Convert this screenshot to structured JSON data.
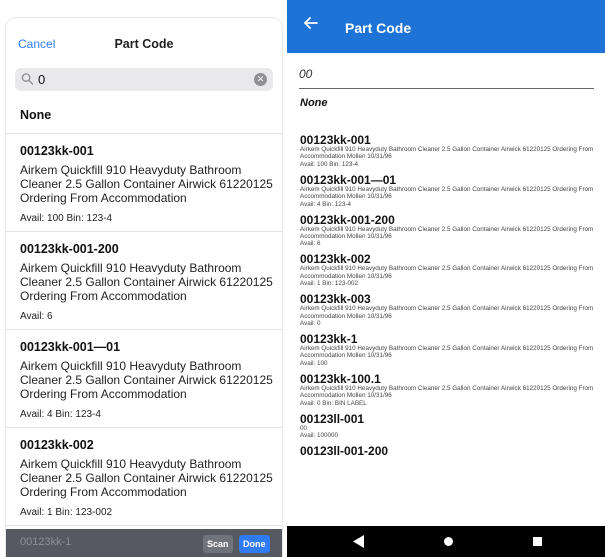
{
  "ios": {
    "nav": {
      "cancel_label": "Cancel",
      "title": "Part Code"
    },
    "search": {
      "query": "0"
    },
    "none_label": "None",
    "items": [
      {
        "code": "00123kk-001",
        "description": "Airkem Quickfill 910 Heavyduty Bathroom Cleaner 2.5 Gallon Container Airwick 61220125 Ordering From Accommodation",
        "avail": "Avail: 100  Bin: 123-4"
      },
      {
        "code": "00123kk-001-200",
        "description": "Airkem Quickfill 910 Heavyduty Bathroom Cleaner 2.5 Gallon Container Airwick 61220125 Ordering From Accommodation",
        "avail": "Avail: 6"
      },
      {
        "code": "00123kk-001—01",
        "description": "Airkem Quickfill 910 Heavyduty Bathroom Cleaner 2.5 Gallon Container Airwick 61220125 Ordering From Accommodation",
        "avail": "Avail: 4   Bin: 123-4"
      },
      {
        "code": "00123kk-002",
        "description": "Airkem Quickfill 910 Heavyduty Bathroom Cleaner 2.5 Gallon Container Airwick 61220125 Ordering From Accommodation",
        "avail": "Avail: 1   Bin: 123-002"
      }
    ],
    "keyboard": {
      "ghost_text": "00123kk-1",
      "scan_label": "Scan",
      "done_label": "Done"
    }
  },
  "android": {
    "appbar": {
      "title": "Part Code"
    },
    "field_value": "00",
    "none_label": "None",
    "items": [
      {
        "code": "00123kk-001",
        "description": "Airkem Quickfill 910 Heavyduty Bathroom Cleaner 2.5 Gallon Container Airwick 61220125 Ordering From Accommodation Mollen 10/31/96",
        "avail": "Avail: 100  Bin: 123-4"
      },
      {
        "code": "00123kk-001—01",
        "description": "Airkem Quickfill 910 Heavyduty Bathroom Cleaner 2.5 Gallon Container Airwick 61220125 Ordering From Accommodation Mollen 10/31/96",
        "avail": "Avail: 4  Bin: 123-4"
      },
      {
        "code": "00123kk-001-200",
        "description": "Airkem Quickfill 910 Heavyduty Bathroom Cleaner 2.5 Gallon Container Airwick 61220125 Ordering From Accommodation Mollen 10/31/96",
        "avail": "Avail: 6"
      },
      {
        "code": "00123kk-002",
        "description": "Airkem Quickfill 910 Heavyduty Bathroom Cleaner 2.5 Gallon Container Airwick 61220125 Ordering From Accommodation Mollen 10/31/96",
        "avail": "Avail: 1  Bin: 123-002"
      },
      {
        "code": "00123kk-003",
        "description": "Airkem Quickfill 910 Heavyduty Bathroom Cleaner 2.5 Gallon Container Airwick 61220125 Ordering From Accommodation Mollen 10/31/96",
        "avail": "Avail: 0"
      },
      {
        "code": "00123kk-1",
        "description": "Airkem Quickfill 910 Heavyduty Bathroom Cleaner 2.5 Gallon Container Airwick 61220125 Ordering From Accommodation Mollen 10/31/96",
        "avail": "Avail: 100"
      },
      {
        "code": "00123kk-100.1",
        "description": "Airkem Quickfill 910 Heavyduty Bathroom Cleaner 2.5 Gallon Container Airwick 61220125 Ordering From Accommodation Mollen 10/31/96",
        "avail": "Avail: 0  Bin: BIN LABEL"
      },
      {
        "code": "00123ll-001",
        "description": "00",
        "avail": "Avail: 100000"
      },
      {
        "code": "00123ll-001-200",
        "description": "",
        "avail": ""
      }
    ]
  },
  "colors": {
    "ios_accent": "#2f7cf6",
    "android_appbar": "#1e73d6",
    "keyboard_bar": "#565a60"
  },
  "icons": [
    "search-icon",
    "clear-icon",
    "back-arrow-icon",
    "nav-back-icon",
    "nav-home-icon",
    "nav-recents-icon"
  ]
}
